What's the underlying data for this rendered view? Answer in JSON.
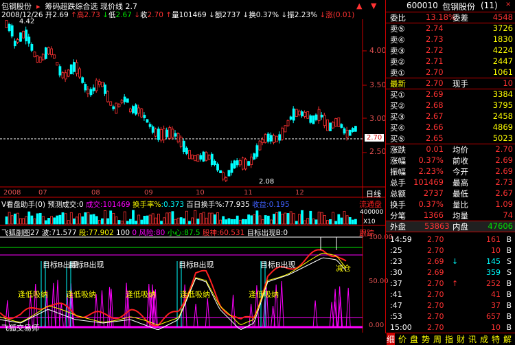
{
  "header": {
    "stock_name": "包钢股份",
    "indicator": "筹码超跌综合选",
    "price_line_label": "现价线",
    "price_line_value": "2.7",
    "date": "2008/12/26",
    "open_label": "开",
    "open": "2.69",
    "high_label": "高",
    "high": "2.73",
    "low_label": "低",
    "low": "2.67",
    "close_label": "收",
    "close": "2.70",
    "volume_label": "量",
    "volume": "101469",
    "amount_label": "额",
    "amount": "2737",
    "turnover_label": "换",
    "turnover": "0.37%",
    "amplitude_label": "振",
    "amplitude": "2.23%",
    "change_label": "涨",
    "change": "(0.01)",
    "hi_marker": "4.42",
    "lo_marker": "2.08"
  },
  "price_axis": [
    "4.00",
    "3.50",
    "3.00",
    "2.50"
  ],
  "current_price_tag": "2.70",
  "month_axis": [
    "2008",
    "07",
    "08",
    "09",
    "10",
    "11",
    "12"
  ],
  "timeframe": "日线",
  "volume_panel": {
    "name": "V看盘助手(0)",
    "predict_label": "预测成交:0",
    "vol_label": "成交",
    "vol_value": "101469",
    "turnover_rate_label": "换手率%",
    "turnover_rate_value": "0.373",
    "hundred_day_label": "百日换手%",
    "hundred_day_value": "77.935",
    "gain_label": "收益",
    "gain_value": "0.195",
    "float_label": "流通盘",
    "scale_top": "400000",
    "scale_bottom": "X10"
  },
  "indicator_panel": {
    "name": "飞狐副图27",
    "wave_label": "波",
    "wave_value": "71.577",
    "segment_label": "段",
    "segment_value": "77.902",
    "hundred": "100",
    "zero": "0",
    "risk_label": "风险",
    "risk_value": "80",
    "caution_label": "小心",
    "caution_value": "87.5",
    "stock_god_label": "股神",
    "stock_god_value": "60.531",
    "target_label": "目标出现",
    "target_value": "B:0",
    "follow_label": "跟踪",
    "axis": [
      "100.00",
      "50.00",
      "0.00"
    ],
    "annotations": {
      "target_out": "目标B出现",
      "low_absorb": "逢低吸纳",
      "reduce": "减仓"
    },
    "footer": "飞狐交易师"
  },
  "quote_panel": {
    "code": "600010",
    "name": "包钢股份",
    "count": "(11)",
    "ratio_label": "委比",
    "ratio_value": "13.18%",
    "diff_label": "委差",
    "diff_value": "4548",
    "asks": [
      {
        "label": "卖⑤",
        "price": "2.74",
        "vol": "3726"
      },
      {
        "label": "卖④",
        "price": "2.73",
        "vol": "1830"
      },
      {
        "label": "卖③",
        "price": "2.72",
        "vol": "4224"
      },
      {
        "label": "卖②",
        "price": "2.71",
        "vol": "2447"
      },
      {
        "label": "卖①",
        "price": "2.70",
        "vol": "1061"
      }
    ],
    "latest_label": "最新",
    "latest_value": "2.70",
    "hand_label": "现手",
    "hand_value": "10",
    "bids": [
      {
        "label": "买①",
        "price": "2.69",
        "vol": "3384"
      },
      {
        "label": "买②",
        "price": "2.68",
        "vol": "3795"
      },
      {
        "label": "买③",
        "price": "2.67",
        "vol": "2458"
      },
      {
        "label": "买④",
        "price": "2.66",
        "vol": "4869"
      },
      {
        "label": "买⑤",
        "price": "2.65",
        "vol": "5023"
      }
    ],
    "stats": [
      {
        "l1": "涨跌",
        "v1": "0.01",
        "l2": "均价",
        "v2": "2.70"
      },
      {
        "l1": "涨幅",
        "v1": "0.37%",
        "l2": "前收",
        "v2": "2.69"
      },
      {
        "l1": "振幅",
        "v1": "2.23%",
        "l2": "今开",
        "v2": "2.69"
      },
      {
        "l1": "总手",
        "v1": "101469",
        "l2": "最高",
        "v2": "2.73"
      },
      {
        "l1": "总额",
        "v1": "2737",
        "l2": "最低",
        "v2": "2.67"
      },
      {
        "l1": "换手",
        "v1": "0.37%",
        "l2": "量比",
        "v2": "1.09"
      },
      {
        "l1": "分笔",
        "v1": "1366",
        "l2": "均量",
        "v2": "74"
      }
    ],
    "outer_label": "外盘",
    "outer_value": "53863",
    "inner_label": "内盘",
    "inner_value": "47606",
    "ticks": [
      {
        "time": "14:59",
        "price": "2.70",
        "arrow": "",
        "vol": "161",
        "side": "B"
      },
      {
        "time": ":25",
        "price": "2.70",
        "arrow": "",
        "vol": "10",
        "side": "B"
      },
      {
        "time": ":23",
        "price": "2.69",
        "arrow": "↓",
        "vol": "145",
        "side": "S"
      },
      {
        "time": ":30",
        "price": "2.69",
        "arrow": "",
        "vol": "359",
        "side": "S"
      },
      {
        "time": ":37",
        "price": "2.70",
        "arrow": "↑",
        "vol": "252",
        "side": "B"
      },
      {
        "time": ":41",
        "price": "2.70",
        "arrow": "",
        "vol": "41",
        "side": "B"
      },
      {
        "time": ":47",
        "price": "2.70",
        "arrow": "",
        "vol": "37",
        "side": "B"
      },
      {
        "time": ":53",
        "price": "2.70",
        "arrow": "",
        "vol": "657",
        "side": "B"
      },
      {
        "time": "15:00",
        "price": "2.70",
        "arrow": "",
        "vol": "10",
        "side": "B"
      }
    ],
    "tabs": [
      "细",
      "价",
      "盘",
      "势",
      "周",
      "指",
      "财",
      "讯",
      "成",
      "特",
      "解"
    ]
  }
}
